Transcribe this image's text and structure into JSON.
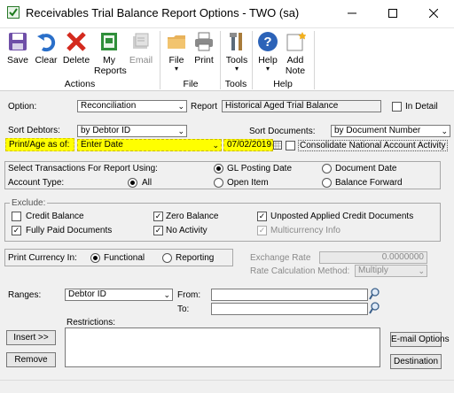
{
  "window": {
    "title": "Receivables Trial Balance Report Options  -  TWO (sa)"
  },
  "ribbon": {
    "buttons": {
      "save": "Save",
      "clear": "Clear",
      "delete": "Delete",
      "my_reports": "My",
      "my_reports2": "Reports",
      "email": "Email",
      "file": "File",
      "print": "Print",
      "tools": "Tools",
      "help": "Help",
      "add_note": "Add",
      "add_note2": "Note"
    },
    "groups": {
      "actions": "Actions",
      "file": "File",
      "tools": "Tools",
      "help": "Help"
    }
  },
  "form": {
    "option_label": "Option:",
    "option_value": "Reconciliation",
    "report_label": "Report",
    "report_value": "Historical Aged Trial Balance",
    "in_detail_label": "In Detail",
    "sort_debtors_label": "Sort Debtors:",
    "sort_debtors_value": "by Debtor ID",
    "sort_documents_label": "Sort Documents:",
    "sort_documents_value": "by Document Number",
    "print_age_label": "Print/Age as of:",
    "print_age_value": "Enter Date",
    "date_value": "07/02/2019",
    "consolidate_label": "Consolidate National Account Activity",
    "select_trans_label": "Select Transactions For Report Using:",
    "gl_posting_label": "GL Posting Date",
    "document_date_label": "Document Date",
    "account_type_label": "Account Type:",
    "all_label": "All",
    "open_item_label": "Open Item",
    "balance_forward_label": "Balance Forward",
    "exclude_label": "Exclude:",
    "credit_balance_label": "Credit Balance",
    "zero_balance_label": "Zero Balance",
    "unposted_label": "Unposted Applied Credit Documents",
    "fully_paid_label": "Fully Paid Documents",
    "no_activity_label": "No Activity",
    "multicurrency_label": "Multicurrency Info",
    "print_currency_label": "Print Currency In:",
    "functional_label": "Functional",
    "reporting_label": "Reporting",
    "exchange_rate_label": "Exchange Rate",
    "exchange_rate_value": "0.0000000",
    "rate_calc_label": "Rate Calculation Method:",
    "rate_calc_value": "Multiply",
    "ranges_label": "Ranges:",
    "ranges_value": "Debtor ID",
    "from_label": "From:",
    "to_label": "To:",
    "restrictions_label": "Restrictions:",
    "insert_label": "Insert >>",
    "remove_label": "Remove",
    "email_options_label": "E-mail Options",
    "destination_label": "Destination"
  }
}
